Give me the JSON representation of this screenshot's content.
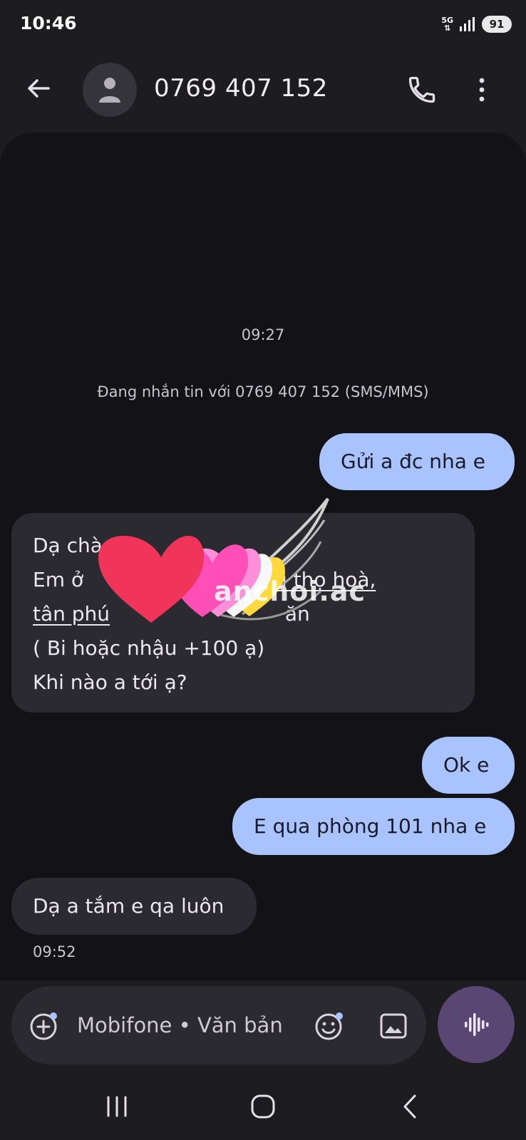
{
  "status_bar": {
    "time": "10:46",
    "network": "5G",
    "battery": "91"
  },
  "header": {
    "title": "0769 407 152"
  },
  "conversation": {
    "timestamp_top": "09:27",
    "info_text": "Đang nhắn tin với 0769 407 152 (SMS/MMS)",
    "msg1": "Gửi a đc nha e",
    "msg2": {
      "line1": "Dạ chà",
      "line2_start": "Em ở",
      "line2_link": "ới, phú thọ hoà,",
      "line3_link": "tân phú",
      "line3_end": "ăn",
      "line4": "( Bi hoặc nhậu +100 ạ)",
      "line5": "Khi nào a tới ạ?"
    },
    "msg3": "Ok e",
    "msg4": "E qua phòng 101 nha e",
    "msg5": "Dạ a tắm e qa luôn",
    "timestamp_bottom": "09:52"
  },
  "composer": {
    "placeholder": "Mobifone • Văn bản"
  },
  "watermark": {
    "text": "anchoi.ac"
  }
}
